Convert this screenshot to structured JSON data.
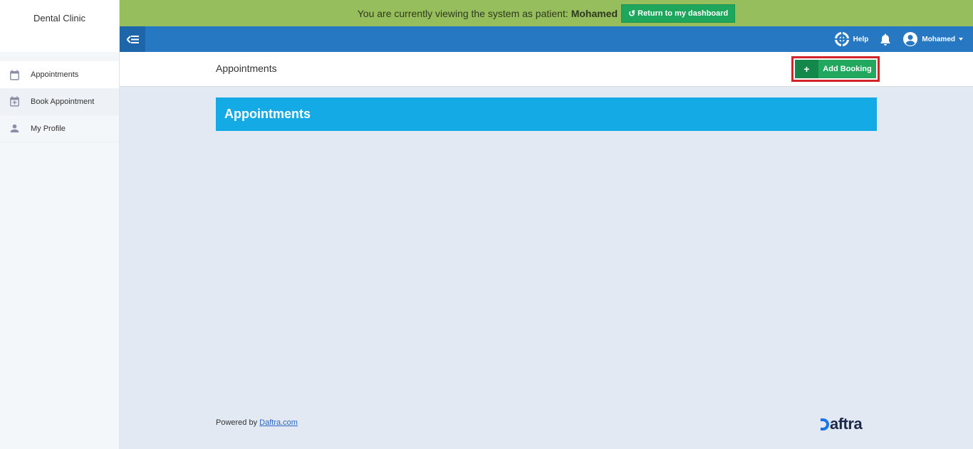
{
  "app": {
    "brand": "Dental Clinic"
  },
  "sidebar": {
    "items": [
      {
        "label": "Appointments",
        "icon": "calendar-icon"
      },
      {
        "label": "Book Appointment",
        "icon": "calendar-add-icon"
      },
      {
        "label": "My Profile",
        "icon": "person-icon"
      }
    ]
  },
  "impersonation": {
    "message": "You are currently viewing the system as patient:",
    "patient_name": "Mohamed",
    "return_label": "Return to my dashboard"
  },
  "topbar": {
    "help_label": "Help",
    "user_name": "Mohamed"
  },
  "page": {
    "title": "Appointments",
    "add_booking_label": "Add Booking",
    "add_icon": "+",
    "panel_title": "Appointments"
  },
  "footer": {
    "powered_by": "Powered by",
    "link_text": "Daftra.com",
    "logo_text": "aftra"
  },
  "colors": {
    "impersonation_bar": "#97be5c",
    "topbar": "#2778c2",
    "panel_header": "#14aae6",
    "add_booking": "#22a75e",
    "highlight_border": "#d2232a"
  }
}
